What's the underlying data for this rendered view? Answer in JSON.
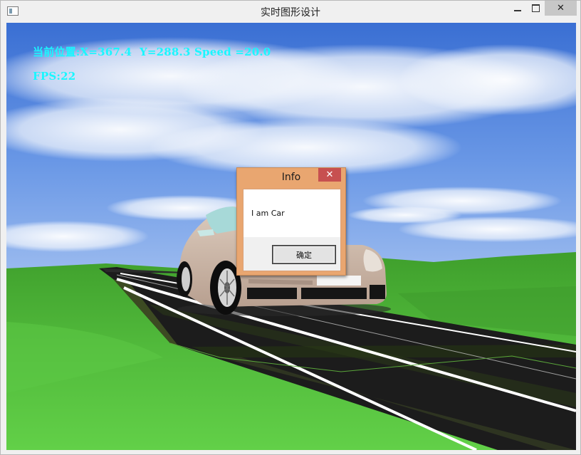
{
  "window": {
    "title": "实时图形设计",
    "close_glyph": "✕"
  },
  "hud": {
    "position_text": "当前位置:X=367.4  Y=288.3 Speed =20.0",
    "fps_text": "FPS:22",
    "color": "#19f7ff"
  },
  "dialog": {
    "title": "Info",
    "close_glyph": "✕",
    "message": "I am Car",
    "ok_label": "确定"
  },
  "scene": {
    "sky_color": "#4f7fd9",
    "grass_color": "#4fb83a",
    "road_color": "#1e1e1e",
    "car_color": "#c9b5a6"
  }
}
